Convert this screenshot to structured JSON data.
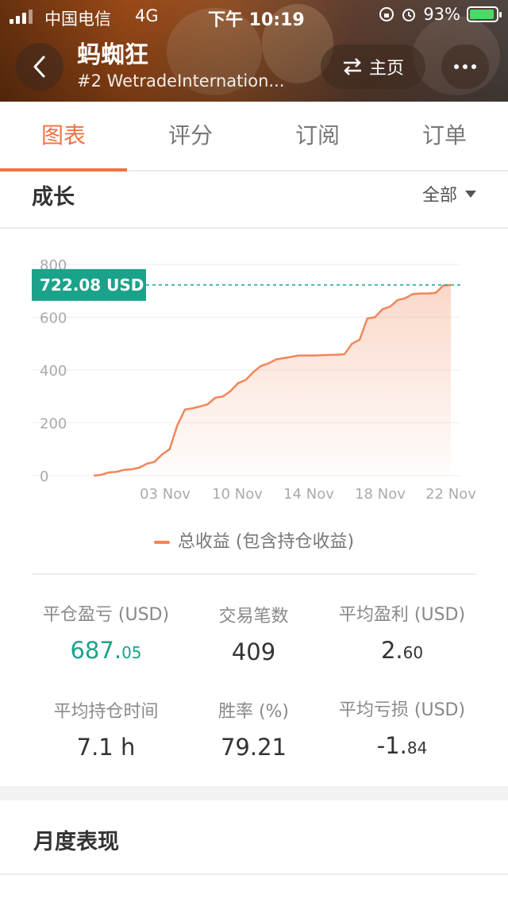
{
  "status_bar": {
    "carrier": "中国电信",
    "network": "4G",
    "time": "下午 10:19",
    "battery": "93%"
  },
  "header": {
    "title": "蚂蜘狂",
    "subtitle": "#2 WetradeInternation...",
    "home_label": "主页"
  },
  "tabs": [
    {
      "label": "图表",
      "active": true
    },
    {
      "label": "评分"
    },
    {
      "label": "订阅"
    },
    {
      "label": "订单"
    }
  ],
  "growth": {
    "title": "成长",
    "filter_value": "全部"
  },
  "chart_data": {
    "type": "area",
    "x_labels": [
      "03 Nov",
      "10 Nov",
      "14 Nov",
      "18 Nov",
      "22 Nov"
    ],
    "y_ticks": [
      "800",
      "600",
      "400",
      "200",
      "0"
    ],
    "ylim": [
      0,
      800
    ],
    "current_value_label": "722.08 USD",
    "current_value": 722.08,
    "series": [
      {
        "name": "总收益 (包含持仓收益)",
        "color": "#f0865a",
        "values": [
          0,
          3,
          12,
          14,
          22,
          24,
          30,
          45,
          52,
          80,
          100,
          190,
          250,
          255,
          262,
          270,
          295,
          300,
          320,
          350,
          362,
          392,
          415,
          425,
          440,
          445,
          450,
          455,
          455,
          455,
          456,
          457,
          458,
          460,
          500,
          515,
          595,
          600,
          630,
          640,
          665,
          672,
          688,
          690,
          690,
          692,
          720,
          722
        ]
      }
    ],
    "grid": true
  },
  "stats": [
    {
      "label": "平仓盈亏 (USD)",
      "value_int": "687.",
      "value_dec": "05",
      "accent": true
    },
    {
      "label": "交易笔数",
      "value_int": "409",
      "value_dec": ""
    },
    {
      "label": "平均盈利 (USD)",
      "value_int": "2.",
      "value_dec": "60"
    },
    {
      "label": "平均持仓时间",
      "value_int": "7.1 h",
      "value_dec": ""
    },
    {
      "label": "胜率 (%)",
      "value_int": "79.21",
      "value_dec": ""
    },
    {
      "label": "平均亏损 (USD)",
      "value_int": "-1.",
      "value_dec": "84"
    }
  ],
  "monthly": {
    "title": "月度表现"
  }
}
